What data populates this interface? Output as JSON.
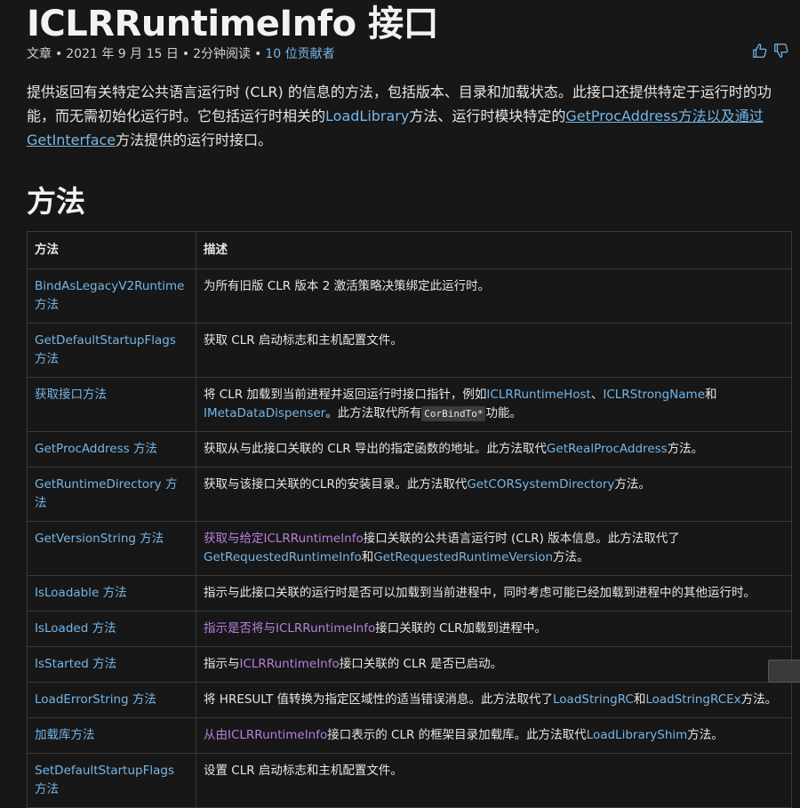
{
  "page": {
    "title": "ICLRRuntimeInfo 接口",
    "meta": {
      "type": "文章",
      "date": "2021 年 9 月 15 日",
      "read_time": "2分钟阅读",
      "contributors": "10 位贡献者"
    },
    "intro": {
      "p1": "提供返回有关特定公共语言运行时 (CLR) 的信息的方法，包括版本、目录和加载状态。此接口还提供特定于运行时的功能，而无需初始化运行时。它包括运行时相关的",
      "link1": "LoadLibrary",
      "p2": "方法、运行时模块特定的",
      "link2": "GetProcAddress方法以及通过GetInterface",
      "p3": "方法提供的运行时接口。"
    },
    "section_title": "方法",
    "table": {
      "headers": [
        "方法",
        "描述"
      ],
      "rows": [
        {
          "method": "BindAsLegacyV2Runtime 方法",
          "desc": [
            {
              "t": "为所有旧版 CLR 版本 2 激活策略决策绑定此运行时。"
            }
          ]
        },
        {
          "method": "GetDefaultStartupFlags 方法",
          "desc": [
            {
              "t": "获取 CLR 启动标志和主机配置文件。"
            }
          ]
        },
        {
          "method": "获取接口方法",
          "desc": [
            {
              "t": "将 CLR 加载到当前进程并返回运行时接口指针，例如"
            },
            {
              "t": "ICLRRuntimeHost",
              "k": "link"
            },
            {
              "t": "、"
            },
            {
              "t": "ICLRStrongName",
              "k": "link"
            },
            {
              "t": "和"
            },
            {
              "t": "IMetaDataDispenser",
              "k": "link"
            },
            {
              "t": "。此方法取代所有"
            },
            {
              "t": "CorBindTo*",
              "k": "code"
            },
            {
              "t": "功能。"
            }
          ]
        },
        {
          "method": "GetProcAddress 方法",
          "desc": [
            {
              "t": "获取从与此接口关联的 CLR 导出的指定函数的地址。此方法取代"
            },
            {
              "t": "GetRealProcAddress",
              "k": "link"
            },
            {
              "t": "方法。"
            }
          ]
        },
        {
          "method": "GetRuntimeDirectory 方法",
          "desc": [
            {
              "t": "获取与该接口关联的CLR的安装目录。此方法取代"
            },
            {
              "t": "GetCORSystemDirectory",
              "k": "link"
            },
            {
              "t": "方法。"
            }
          ]
        },
        {
          "method": "GetVersionString 方法",
          "desc": [
            {
              "t": "获取与给定",
              "k": "visited"
            },
            {
              "t": "ICLRRuntimeInfo",
              "k": "visited"
            },
            {
              "t": "接口关联的公共语言运行时 (CLR) 版本信息。此方法取代了"
            },
            {
              "t": "GetRequestedRuntimeInfo",
              "k": "link"
            },
            {
              "t": "和"
            },
            {
              "t": "GetRequestedRuntimeVersion",
              "k": "link"
            },
            {
              "t": "方法。"
            }
          ]
        },
        {
          "method": "IsLoadable 方法",
          "desc": [
            {
              "t": "指示与此接口关联的运行时是否可以加载到当前进程中，同时考虑可能已经加载到进程中的其他运行时。"
            }
          ]
        },
        {
          "method": "IsLoaded 方法",
          "desc": [
            {
              "t": "指示是否将与",
              "k": "visited"
            },
            {
              "t": "ICLRRuntimeInfo",
              "k": "visited"
            },
            {
              "t": "接口关联的 CLR加载到进程中。"
            }
          ]
        },
        {
          "method": "IsStarted 方法",
          "desc": [
            {
              "t": "指示与"
            },
            {
              "t": "ICLRRuntimeInfo",
              "k": "visited"
            },
            {
              "t": "接口关联的 CLR 是否已启动。"
            }
          ]
        },
        {
          "method": "LoadErrorString 方法",
          "desc": [
            {
              "t": "将 HRESULT 值转换为指定区域性的适当错误消息。此方法取代了"
            },
            {
              "t": "LoadStringRC",
              "k": "link"
            },
            {
              "t": "和"
            },
            {
              "t": "LoadStringRCEx",
              "k": "link"
            },
            {
              "t": "方法。"
            }
          ]
        },
        {
          "method": "加载库方法",
          "desc": [
            {
              "t": "从由",
              "k": "visited"
            },
            {
              "t": "ICLRRuntimeInfo",
              "k": "visited"
            },
            {
              "t": "接口表示的 CLR 的框架目录加载库。此方法取代"
            },
            {
              "t": "LoadLibraryShim",
              "k": "link"
            },
            {
              "t": "方法。"
            }
          ]
        },
        {
          "method": "SetDefaultStartupFlags 方法",
          "desc": [
            {
              "t": "设置 CLR 启动标志和主机配置文件。"
            }
          ]
        }
      ]
    },
    "icons": {
      "like": "thumbs-up-icon",
      "dislike": "thumbs-down-icon"
    },
    "colors": {
      "background": "#171717",
      "link": "#75b6e7",
      "visited": "#b77fdb",
      "text": "#e6e6e6"
    }
  }
}
